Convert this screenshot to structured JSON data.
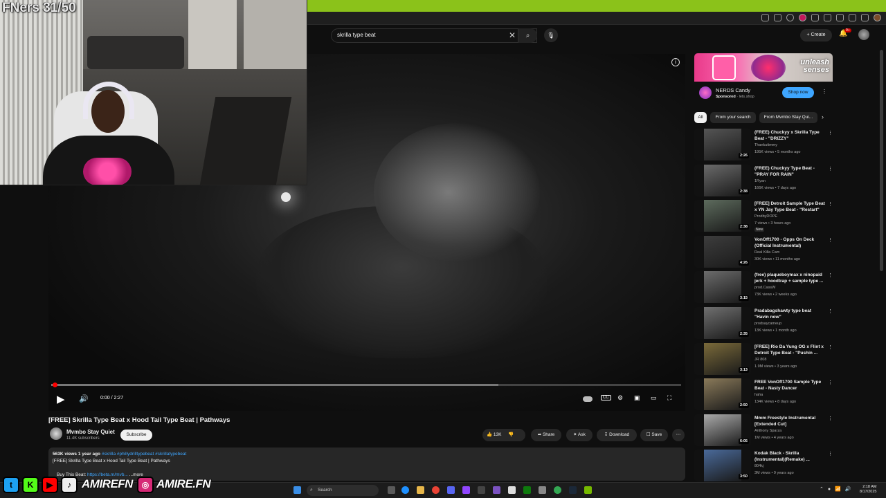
{
  "stream_overlay": {
    "counter": "FNers 31/50",
    "social": [
      {
        "icon": "twitter-icon",
        "glyph": "t",
        "color": "#1da1f2"
      },
      {
        "icon": "kick-icon",
        "glyph": "K",
        "color": "#53fc18"
      },
      {
        "icon": "youtube-icon",
        "glyph": "▶",
        "color": "#ff0000"
      },
      {
        "icon": "tiktok-icon",
        "glyph": "♪",
        "color": "#eeeeee"
      }
    ],
    "handle_1": "AMIREFN",
    "instagram_glyph": "◎",
    "handle_2": "AMIRE.FN"
  },
  "search": {
    "query": "skrilla type beat",
    "clear_glyph": "✕",
    "search_glyph": "⌕",
    "mic_glyph": "🎙"
  },
  "header": {
    "create_label": "+ Create",
    "notif_count": "9+"
  },
  "player": {
    "time": "0:00 / 2:27",
    "progress_buffer": 0.71
  },
  "video": {
    "title": "[FREE] Skrilla Type Beat x Hood Tail Type Beat | Pathways",
    "channel": "Mvmbo Stay Quiet",
    "subscribers": "11.4K subscribers",
    "subscribe_label": "Subscribe",
    "likes": "13K",
    "share_label": "Share",
    "ask_label": "Ask",
    "download_label": "Download",
    "save_label": "Save",
    "views_date": "563K views  1 year ago",
    "tags": "#skrilla #phillydrilltypebeat #skrillatypebeat",
    "description": "[FREE] Skrilla Type Beat x Hood Tail Type Beat | Pathways",
    "buy_prefix": "Buy This Beat:",
    "buy_link": "https://beta.m/mvb...",
    "more": "...more"
  },
  "ad": {
    "banner_text_1": "unleash",
    "banner_text_2": "senses",
    "title": "NERDS Candy",
    "sponsored": "Sponsored",
    "domain": "· lets.shop",
    "cta": "Shop now"
  },
  "chips": [
    "All",
    "From your search",
    "From Mvmbo Stay Qui..."
  ],
  "recommendations": [
    {
      "title": "(FREE) Chuckyy x Skrilla Type Beat - \"DRIZZY\"",
      "channel": "Thankutimmy",
      "meta": "195K views • 5 months ago",
      "duration": "2:26",
      "new": ""
    },
    {
      "title": "(FREE) Chuckyy Type Beat - \"PRAY FOR RAIN\"",
      "channel": "1Ryan",
      "meta": "166K views • 7 days ago",
      "duration": "2:38",
      "new": ""
    },
    {
      "title": "[FREE] Detroit Sample Type Beat x YN Jay Type Beat - \"Restart\"",
      "channel": "ProdbyDOPE",
      "meta": "7 views • 3 hours ago",
      "duration": "2:38",
      "new": "New"
    },
    {
      "title": "VonOff1700 - Opps On Deck (Official Instrumental)",
      "channel": "Real Killa Cam",
      "meta": "30K views • 11 months ago",
      "duration": "4:26",
      "new": ""
    },
    {
      "title": "(free) plaqueboymax x ninopaid jerk + hoodtrap + sample type ...",
      "channel": "prod.CassW",
      "meta": "73K views • 2 weeks ago",
      "duration": "3:15",
      "new": ""
    },
    {
      "title": "Pradabagshawty type beat \"Havin now\"",
      "channel": "prodsaycameup",
      "meta": "13K views • 1 month ago",
      "duration": "2:35",
      "new": ""
    },
    {
      "title": "[FREE] Rio Da Yung OG x Flint x Detroit Type Beat - \"Pushin ...",
      "channel": "JR 808",
      "meta": "1.9M views • 3 years ago",
      "duration": "3:13",
      "new": ""
    },
    {
      "title": "FREE VonOff1700 Sample Type Beat - Nasty Dancer",
      "channel": "haha",
      "meta": "134K views • 8 days ago",
      "duration": "2:50",
      "new": ""
    },
    {
      "title": "Mmm Freestyle Instrumental [Extended Cut]",
      "channel": "Anthony Sparza",
      "meta": "1M views • 4 years ago",
      "duration": "6:05",
      "new": ""
    },
    {
      "title": "Kodak Black - Skrilla (Instrumental)(Remake) ...",
      "channel": "804kj",
      "meta": "3M views • 9 years ago",
      "duration": "3:50",
      "new": ""
    }
  ],
  "taskbar": {
    "search_placeholder": "Search",
    "time": "2:18 AM",
    "date": "8/17/2025"
  },
  "colors": {
    "chrome_green": "#8bc21a",
    "yt_bg": "#0f0f0f",
    "progress_red": "#ff0000",
    "link_blue": "#3ea6ff"
  }
}
